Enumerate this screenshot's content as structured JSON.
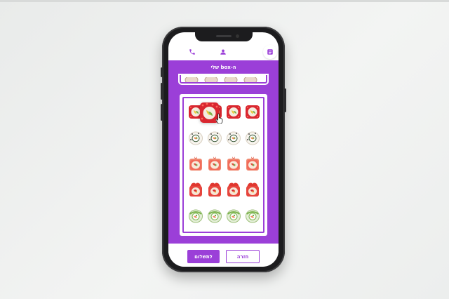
{
  "app": {
    "header_title": "ה-box שלי",
    "nav": [
      {
        "icon": "phone-icon"
      },
      {
        "icon": "user-icon"
      },
      {
        "icon": "box-list-icon",
        "active": true
      }
    ]
  },
  "buttons": {
    "pay_label": "לתשלום",
    "back_label": "חזרה"
  },
  "box": {
    "rows": [
      {
        "type": "red-roll",
        "count": 4
      },
      {
        "type": "white-roll",
        "count": 4
      },
      {
        "type": "salmon-roll",
        "count": 4
      },
      {
        "type": "red-topped-roll",
        "count": 4
      },
      {
        "type": "green-roll",
        "count": 4
      }
    ],
    "dragged_piece": "red-roll"
  },
  "colors": {
    "accent": "#9b3fd8",
    "background": "#eceeed",
    "phone_frame": "#1c1c1e"
  }
}
